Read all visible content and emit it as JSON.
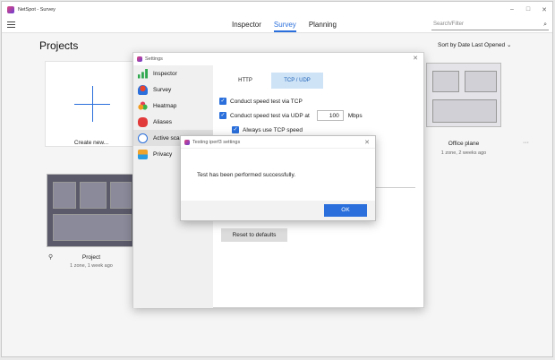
{
  "window": {
    "title": "NetSpot - Survey",
    "controls": [
      "–",
      "□",
      "✕"
    ]
  },
  "toolbar": {
    "tabs": [
      {
        "label": "Inspector",
        "active": false
      },
      {
        "label": "Survey",
        "active": true
      },
      {
        "label": "Planning",
        "active": false
      }
    ],
    "search_placeholder": "Search/Filter",
    "search_icon": "⌕"
  },
  "projects": {
    "title": "Projects",
    "sort_label": "Sort by Date Last Opened ⌄",
    "create_label": "Create new...",
    "cards": [
      {
        "name": "Office plane",
        "sub": "1 zone, 2 weeks ago"
      },
      {
        "name": "Project",
        "sub": "1 zone, 1 week ago"
      }
    ],
    "more_icon": "···",
    "pin_icon": "⚲"
  },
  "settings": {
    "title": "Settings",
    "close": "✕",
    "sidebar": [
      {
        "label": "Inspector",
        "icon": "bars-icon"
      },
      {
        "label": "Survey",
        "icon": "survey-icon"
      },
      {
        "label": "Heatmap",
        "icon": "heat-icon"
      },
      {
        "label": "Aliases",
        "icon": "alias-icon"
      },
      {
        "label": "Active scan",
        "icon": "scan-icon"
      },
      {
        "label": "Privacy",
        "icon": "privacy-icon"
      }
    ],
    "segments": {
      "http": "HTTP",
      "tcp_udp": "TCP / UDP"
    },
    "options": {
      "tcp": "Conduct speed test via TCP",
      "udp": "Conduct speed test via UDP at",
      "udp_value": "100",
      "udp_unit": "Mbps",
      "always_tcp": "Always use TCP speed"
    },
    "check": "✓",
    "reset_label": "Reset to defaults"
  },
  "dialog": {
    "title": "Testing iperf3 settings",
    "close": "✕",
    "message": "Test has been performed successfully.",
    "ok_label": "OK"
  }
}
